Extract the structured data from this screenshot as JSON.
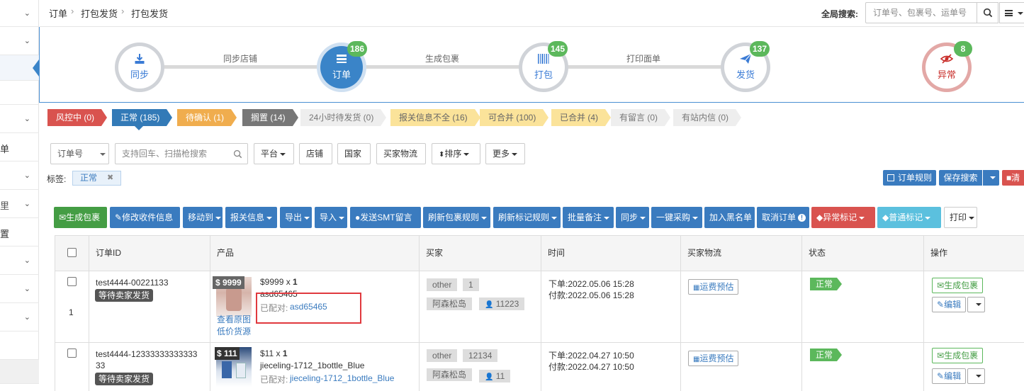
{
  "breadcrumb": [
    "订单",
    "打包发货",
    "打包发货"
  ],
  "global_search": {
    "label": "全局搜索:",
    "placeholder": "订单号、包裹号、运单号"
  },
  "steps": [
    {
      "label": "同步",
      "icon": "download-icon",
      "badge": ""
    },
    {
      "label": "订单",
      "icon": "list-icon",
      "badge": "186"
    },
    {
      "label": "打包",
      "icon": "barcode-icon",
      "badge": "145"
    },
    {
      "label": "发货",
      "icon": "paper-plane-icon",
      "badge": "137"
    },
    {
      "label": "异常",
      "icon": "eye-slash-icon",
      "badge": "8"
    }
  ],
  "step_links": [
    "同步店铺",
    "生成包裹",
    "打印面单"
  ],
  "status_tags": [
    {
      "label": "风控中 (0)",
      "color": "#d9534f"
    },
    {
      "label": "正常 (185)",
      "color": "#337ab7"
    },
    {
      "label": "待确认 (1)",
      "color": "#f0ad4e"
    },
    {
      "label": "搁置 (14)",
      "color": "#777777"
    },
    {
      "label": "24小时待发货 (0)",
      "color": "#eeeeee"
    },
    {
      "label": "报关信息不全 (16)",
      "color": "#fbe39a"
    },
    {
      "label": "可合并 (100)",
      "color": "#fbe39a"
    },
    {
      "label": "已合并 (4)",
      "color": "#fbe39a"
    },
    {
      "label": "有留言 (0)",
      "color": "#eeeeee"
    },
    {
      "label": "有站内信 (0)",
      "color": "#eeeeee"
    }
  ],
  "filters": {
    "order_select": "订单号",
    "search_placeholder": "支持回车、扫描枪搜索",
    "platform": "平台",
    "shop": "店铺",
    "country": "国家",
    "buyer_logistics": "买家物流",
    "sort": "排序",
    "more": "更多"
  },
  "tags_label": "标签:",
  "active_tag": "正常",
  "right_buttons": {
    "order_rules": "订单规则",
    "save_search": "保存搜索",
    "clear": "清"
  },
  "actions": [
    "生成包裹",
    "修改收件信息",
    "移动到",
    "报关信息",
    "导出",
    "导入",
    "发送SMT留言",
    "刷新包裹规则",
    "刷新标记规则",
    "批量备注",
    "同步",
    "一键采购",
    "加入黑名单",
    "取消订单",
    "异常标记",
    "普通标记",
    "打印"
  ],
  "columns": [
    "订单ID",
    "产品",
    "买家",
    "时间",
    "买家物流",
    "状态",
    "操作"
  ],
  "rows": [
    {
      "order_id": "test4444-00221133",
      "order_status": "等待卖家发货",
      "index": "1",
      "price_badge": "$ 9999",
      "price_qty": "$9999 x ",
      "qty": "1",
      "sku": "asd65465",
      "matched_label": "已配对:",
      "matched_sku": "asd65465",
      "view_image": "查看原图",
      "low_price": "低价货源",
      "buyer_tag1": "other",
      "buyer_num": "1",
      "buyer_name": "阿森松岛",
      "buyer_count": "11223",
      "order_time": "下单:2022.05.06 15:28",
      "pay_time": "付款:2022.05.06 15:28",
      "logistics_btn": "运费预估",
      "status": "正常",
      "op_primary": "生成包裹",
      "op_edit": "编辑"
    },
    {
      "order_id": "test4444-12333333333333",
      "order_id_line2": "33",
      "order_status": "等待卖家发货",
      "price_badge": "$ 111",
      "price_qty": "$11 x ",
      "qty": "1",
      "sku": "jieceling-1712_1bottle_Blue",
      "matched_label": "已配对:",
      "matched_sku": "jieceling-1712_1bottle_Blue",
      "buyer_tag1": "other",
      "buyer_num": "12134",
      "buyer_name": "阿森松岛",
      "buyer_count": "11",
      "order_time": "下单:2022.04.27 10:50",
      "pay_time": "付款:2022.04.27 10:50",
      "logistics_btn": "运费预估",
      "status": "正常",
      "op_primary": "生成包裹",
      "op_edit": "编辑"
    }
  ],
  "sidebar_items": [
    "",
    "",
    "",
    "单",
    "",
    "",
    "置",
    "",
    "",
    ""
  ]
}
